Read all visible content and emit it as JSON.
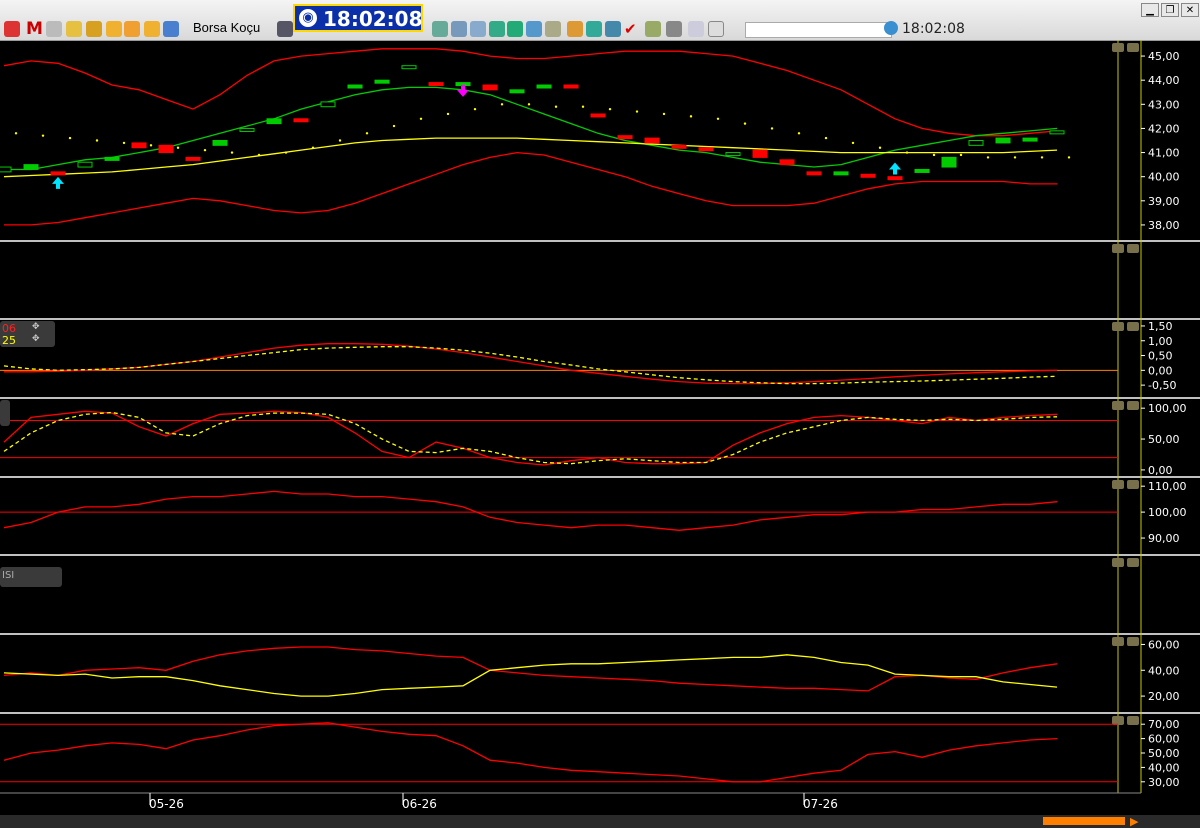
{
  "toolbar": {
    "app_title": "Borsa Koçu",
    "clock_time": "18:02:08",
    "secondary_clock": "18:02:08",
    "icons": [
      "chart-icon",
      "m-logo-icon",
      "draw-icon",
      "line-tool-icon",
      "tool-icon",
      "hourglass-icon",
      "play-icon",
      "export-icon",
      "save-icon",
      "grid-icon",
      "news-icon",
      "globe-icon",
      "chat-icon",
      "check-icon",
      "chart-type-icon",
      "print-icon",
      "window-icon"
    ],
    "window_buttons": [
      "minimize",
      "restore",
      "close"
    ]
  },
  "colors": {
    "red": "#ff0000",
    "green": "#00cc00",
    "yellow": "#ffff00",
    "cyan": "#00e5ff",
    "magenta": "#ff00ff",
    "separator": "#ffffff",
    "axis": "#c8c800"
  },
  "x_axis": {
    "labels": [
      "05-26",
      "06-26",
      "07-26"
    ]
  },
  "panels": [
    {
      "name": "price",
      "y_labels": [
        "45,00",
        "44,00",
        "43,00",
        "42,00",
        "41,00",
        "40,00",
        "39,00",
        "38,00"
      ]
    },
    {
      "name": "empty-1",
      "y_labels": []
    },
    {
      "name": "macd",
      "legend": [
        "06",
        "25"
      ],
      "y_labels": [
        "1,50",
        "1,00",
        "0,50",
        "0,00",
        "-0,50"
      ]
    },
    {
      "name": "stochastic",
      "y_labels": [
        "100,00",
        "50,00",
        "0,00"
      ]
    },
    {
      "name": "momentum",
      "y_labels": [
        "110,00",
        "100,00",
        "90,00"
      ]
    },
    {
      "name": "empty-2",
      "legend": [
        "ISI"
      ],
      "y_labels": []
    },
    {
      "name": "dmi",
      "y_labels": [
        "60,00",
        "40,00",
        "20,00"
      ]
    },
    {
      "name": "rsi",
      "y_labels": [
        "70,00",
        "60,00",
        "50,00",
        "40,00",
        "30,00"
      ]
    }
  ],
  "chart_data": [
    {
      "type": "line",
      "title": "",
      "series": [
        {
          "values": [
            40.3,
            40.3,
            40.5,
            40.7,
            40.8,
            41.0,
            41.2,
            41.5,
            41.8,
            42.1,
            42.4,
            42.8,
            43.1,
            43.4,
            43.6,
            43.7,
            43.7,
            43.6,
            43.4,
            43.0,
            42.6,
            42.2,
            41.8,
            41.5,
            41.3,
            41.1,
            41.0,
            40.8,
            40.6,
            40.5,
            40.4,
            40.5,
            40.8,
            41.1,
            41.3,
            41.5,
            41.7,
            41.8,
            41.9,
            42.0
          ],
          "color": "#00cc00",
          "role": "sma"
        }
      ],
      "ylim": [
        37.5,
        45.5
      ]
    },
    {
      "type": "line",
      "ylim": [
        -0.8,
        1.6
      ]
    },
    {
      "type": "line",
      "ylim": [
        -5,
        110
      ]
    },
    {
      "type": "line",
      "ylim": [
        85,
        112
      ]
    },
    {
      "type": "line",
      "ylim": [
        10,
        65
      ]
    },
    {
      "type": "line",
      "ylim": [
        25,
        75
      ]
    }
  ]
}
